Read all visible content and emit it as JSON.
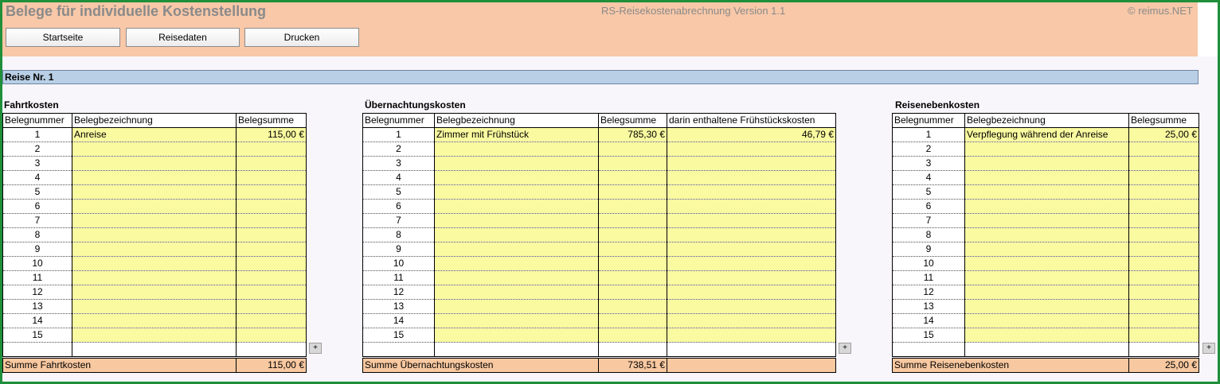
{
  "header": {
    "title": "Belege für individuelle Kostenstellung",
    "version": "RS-Reisekostenabrechnung Version 1.1",
    "copyright": "© reimus.NET",
    "buttons": [
      "Startseite",
      "Reisedaten",
      "Drucken"
    ]
  },
  "reise": {
    "label": "Reise Nr. 1"
  },
  "fahrtkosten": {
    "title": "Fahrtkosten",
    "columns": [
      "Belegnummer",
      "Belegbezeichnung",
      "Belegsumme"
    ],
    "rows": [
      [
        "1",
        "Anreise",
        "115,00 €"
      ],
      [
        "2",
        "",
        ""
      ],
      [
        "3",
        "",
        ""
      ],
      [
        "4",
        "",
        ""
      ],
      [
        "5",
        "",
        ""
      ],
      [
        "6",
        "",
        ""
      ],
      [
        "7",
        "",
        ""
      ],
      [
        "8",
        "",
        ""
      ],
      [
        "9",
        "",
        ""
      ],
      [
        "10",
        "",
        ""
      ],
      [
        "11",
        "",
        ""
      ],
      [
        "12",
        "",
        ""
      ],
      [
        "13",
        "",
        ""
      ],
      [
        "14",
        "",
        ""
      ],
      [
        "15",
        "",
        ""
      ]
    ],
    "sum_label": "Summe Fahrtkosten",
    "sum_value": "115,00 €",
    "expand_label": "+"
  },
  "uebernachtung": {
    "title": "Übernachtungskosten",
    "columns": [
      "Belegnummer",
      "Belegbezeichnung",
      "Belegsumme",
      "darin enthaltene Frühstückskosten"
    ],
    "rows": [
      [
        "1",
        "Zimmer mit Frühstück",
        "785,30 €",
        "46,79 €"
      ],
      [
        "2",
        "",
        "",
        ""
      ],
      [
        "3",
        "",
        "",
        ""
      ],
      [
        "4",
        "",
        "",
        ""
      ],
      [
        "5",
        "",
        "",
        ""
      ],
      [
        "6",
        "",
        "",
        ""
      ],
      [
        "7",
        "",
        "",
        ""
      ],
      [
        "8",
        "",
        "",
        ""
      ],
      [
        "9",
        "",
        "",
        ""
      ],
      [
        "10",
        "",
        "",
        ""
      ],
      [
        "11",
        "",
        "",
        ""
      ],
      [
        "12",
        "",
        "",
        ""
      ],
      [
        "13",
        "",
        "",
        ""
      ],
      [
        "14",
        "",
        "",
        ""
      ],
      [
        "15",
        "",
        "",
        ""
      ]
    ],
    "sum_label": "Summe Übernachtungskosten",
    "sum_value": "738,51 €",
    "expand_label": "+"
  },
  "nebenkosten": {
    "title": "Reisenebenkosten",
    "columns": [
      "Belegnummer",
      "Belegbezeichnung",
      "Belegsumme"
    ],
    "rows": [
      [
        "1",
        "Verpflegung während der Anreise",
        "25,00 €"
      ],
      [
        "2",
        "",
        ""
      ],
      [
        "3",
        "",
        ""
      ],
      [
        "4",
        "",
        ""
      ],
      [
        "5",
        "",
        ""
      ],
      [
        "6",
        "",
        ""
      ],
      [
        "7",
        "",
        ""
      ],
      [
        "8",
        "",
        ""
      ],
      [
        "9",
        "",
        ""
      ],
      [
        "10",
        "",
        ""
      ],
      [
        "11",
        "",
        ""
      ],
      [
        "12",
        "",
        ""
      ],
      [
        "13",
        "",
        ""
      ],
      [
        "14",
        "",
        ""
      ],
      [
        "15",
        "",
        ""
      ]
    ],
    "sum_label": "Summe Reisenebenkosten",
    "sum_value": "25,00 €",
    "expand_label": "+"
  },
  "colors": {
    "frame": "#1f8f3a",
    "header_bg": "#f8c8a8",
    "input_cell": "#fafaa0",
    "sum_row": "#f8c8a0",
    "reise_bar": "#b8cfe6"
  }
}
